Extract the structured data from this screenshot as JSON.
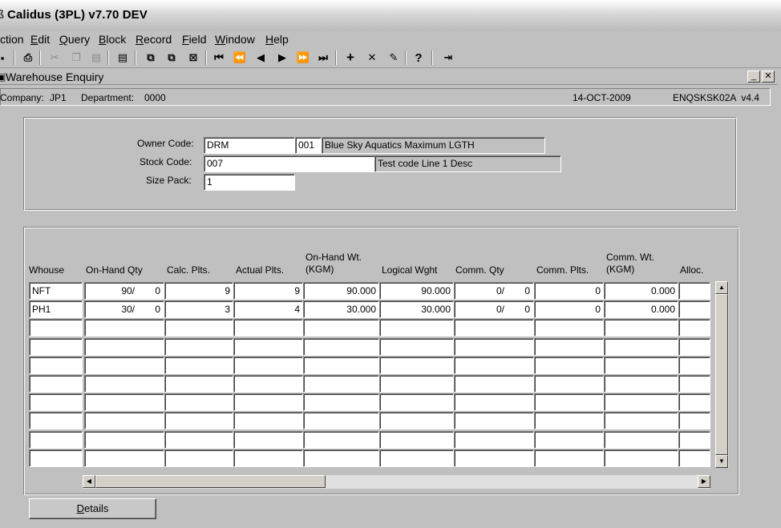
{
  "app": {
    "title": "Calidus (3PL) v7.70 DEV"
  },
  "menu": {
    "items": [
      {
        "label": "ction",
        "u": ""
      },
      {
        "label": "dit",
        "u": "E"
      },
      {
        "label": "uery",
        "u": "Q"
      },
      {
        "label": "lock",
        "u": "B"
      },
      {
        "label": "ecord",
        "u": "R"
      },
      {
        "label": "ield",
        "u": "F"
      },
      {
        "label": "indow",
        "u": "W"
      },
      {
        "label": "elp",
        "u": "H"
      }
    ]
  },
  "toolbar": {
    "icons": [
      "save-icon",
      "print-icon",
      "cut-icon",
      "copy-icon",
      "paste-icon",
      "clear-icon",
      "duplicate-field-icon",
      "duplicate-record-icon",
      "clear-record-icon",
      "first-record-icon",
      "previous-set-icon",
      "previous-record-icon",
      "next-record-icon",
      "next-set-icon",
      "last-record-icon",
      "insert-record-icon",
      "delete-record-icon",
      "lock-record-icon",
      "help-icon",
      "exit-icon"
    ]
  },
  "window": {
    "title": "Warehouse Enquiry"
  },
  "info": {
    "company_label": "Company:",
    "company": "JP1",
    "department_label": "Department:",
    "department": "0000",
    "date": "14-OCT-2009",
    "form_id": "ENQSKSK02A  v4.4"
  },
  "header_form": {
    "owner_code_label": "Owner Code:",
    "owner_code": "DRM",
    "owner_sub": "001",
    "owner_desc": "Blue Sky Aquatics Maximum LGTH",
    "stock_code_label": "Stock Code:",
    "stock_code": "007",
    "stock_desc": "Test code Line 1 Desc",
    "size_pack_label": "Size Pack:",
    "size_pack": "1"
  },
  "grid": {
    "columns": [
      "Whouse",
      "On-Hand Qty",
      "Calc. Plts.",
      "Actual Plts.",
      "On-Hand Wt.\n(KGM)",
      "Logical Wght",
      "Comm. Qty",
      "Comm. Plts.",
      "Comm. Wt.\n(KGM)",
      "Alloc."
    ],
    "rows": [
      {
        "whouse": "NFT",
        "onhand_a": "90/",
        "onhand_b": "0",
        "calc_plts": "9",
        "actual_plts": "9",
        "onhand_wt": "90.000",
        "logical_wght": "90.000",
        "comm_qty_a": "0/",
        "comm_qty_b": "0",
        "comm_plts": "0",
        "comm_wt": "0.000",
        "alloc": ""
      },
      {
        "whouse": "PH1",
        "onhand_a": "30/",
        "onhand_b": "0",
        "calc_plts": "3",
        "actual_plts": "4",
        "onhand_wt": "30.000",
        "logical_wght": "30.000",
        "comm_qty_a": "0/",
        "comm_qty_b": "0",
        "comm_plts": "0",
        "comm_wt": "0.000",
        "alloc": ""
      }
    ],
    "empty_rows": 8
  },
  "buttons": {
    "details_label": "Details",
    "details_u": "D"
  }
}
